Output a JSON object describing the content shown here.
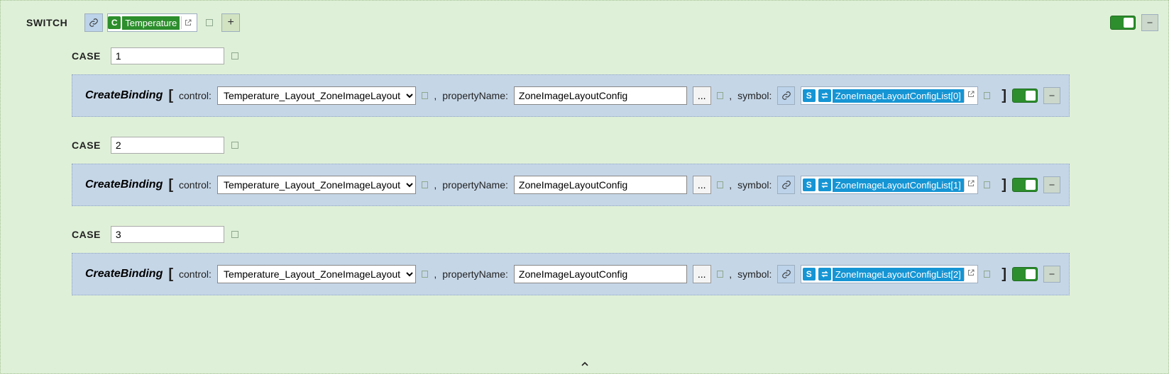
{
  "switch": {
    "label": "SWITCH",
    "expression_chip": "Temperature",
    "expression_letter": "C"
  },
  "cases": [
    {
      "label": "CASE",
      "value": "1",
      "binding": {
        "func": "CreateBinding",
        "control_label": "control:",
        "control_value": "Temperature_Layout_ZoneImageLayout",
        "property_label": "propertyName:",
        "property_value": "ZoneImageLayoutConfig",
        "symbol_label": "symbol:",
        "symbol_letter": "S",
        "symbol_text": "ZoneImageLayoutConfigList[0]"
      }
    },
    {
      "label": "CASE",
      "value": "2",
      "binding": {
        "func": "CreateBinding",
        "control_label": "control:",
        "control_value": "Temperature_Layout_ZoneImageLayout",
        "property_label": "propertyName:",
        "property_value": "ZoneImageLayoutConfig",
        "symbol_label": "symbol:",
        "symbol_letter": "S",
        "symbol_text": "ZoneImageLayoutConfigList[1]"
      }
    },
    {
      "label": "CASE",
      "value": "3",
      "binding": {
        "func": "CreateBinding",
        "control_label": "control:",
        "control_value": "Temperature_Layout_ZoneImageLayout",
        "property_label": "propertyName:",
        "property_value": "ZoneImageLayoutConfig",
        "symbol_label": "symbol:",
        "symbol_letter": "S",
        "symbol_text": "ZoneImageLayoutConfigList[2]"
      }
    }
  ],
  "glyphs": {
    "ellipsis": "...",
    "plus": "+"
  }
}
